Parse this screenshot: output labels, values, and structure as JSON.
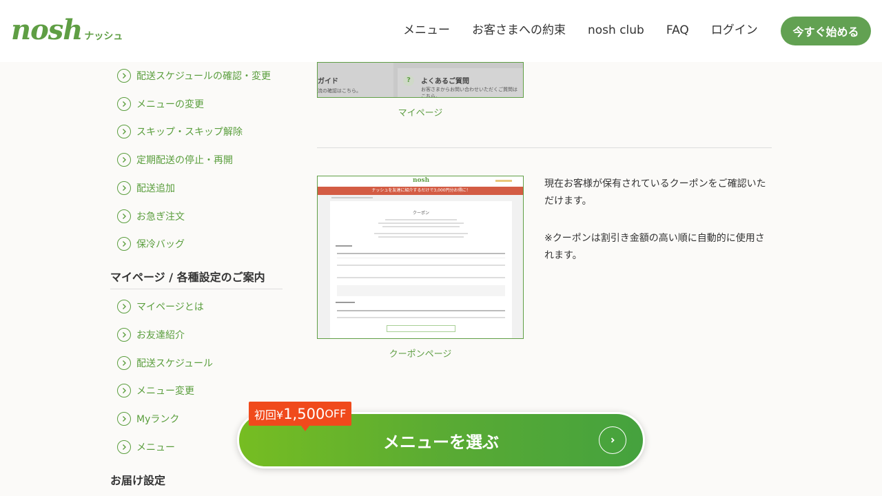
{
  "header": {
    "logo_text": "nosh",
    "logo_sub": "ナッシュ",
    "nav": [
      "メニュー",
      "お客さまへの約束",
      "nosh club",
      "FAQ",
      "ログイン"
    ],
    "cta": "今すぐ始める"
  },
  "sidebar": {
    "items_top": [
      "配送スケジュールの確認・変更",
      "メニューの変更",
      "スキップ・スキップ解除",
      "定期配送の停止・再開",
      "配送追加",
      "お急ぎ注文",
      "保冷バッグ"
    ],
    "section_mypage": "マイページ / 各種設定のご案内",
    "items_mypage": [
      "マイページとは",
      "お友達紹介",
      "配送スケジュール",
      "メニュー変更",
      "Myランク",
      "メニュー"
    ],
    "section_delivery": "お届け設定"
  },
  "main": {
    "mypage_thumb": {
      "guide_text": "ガイド",
      "guide_sub": "流の確認はこちら。",
      "faq_title": "よくあるご質問",
      "faq_sub": "お客さまからお問い合わせいただくご質問はこちら。"
    },
    "mypage_caption": "マイページ",
    "coupon_thumb": {
      "logo": "nosh",
      "banner": "ナッシュを友達に紹介するだけで3,000円分お得に！",
      "page_title": "クーポン"
    },
    "coupon_caption": "クーポンページ",
    "description": [
      "現在お客様が保有されているクーポンをご確認いただけます。",
      "※クーポンは割引き金額の高い順に自動的に使用されます。"
    ]
  },
  "bottom_cta": {
    "badge_prefix": "初回¥",
    "badge_amount": "1,500",
    "badge_suffix": "OFF",
    "label": "メニューを選ぶ"
  },
  "colors": {
    "brand_green": "#5f9e44",
    "badge_red": "#f04a1c"
  }
}
